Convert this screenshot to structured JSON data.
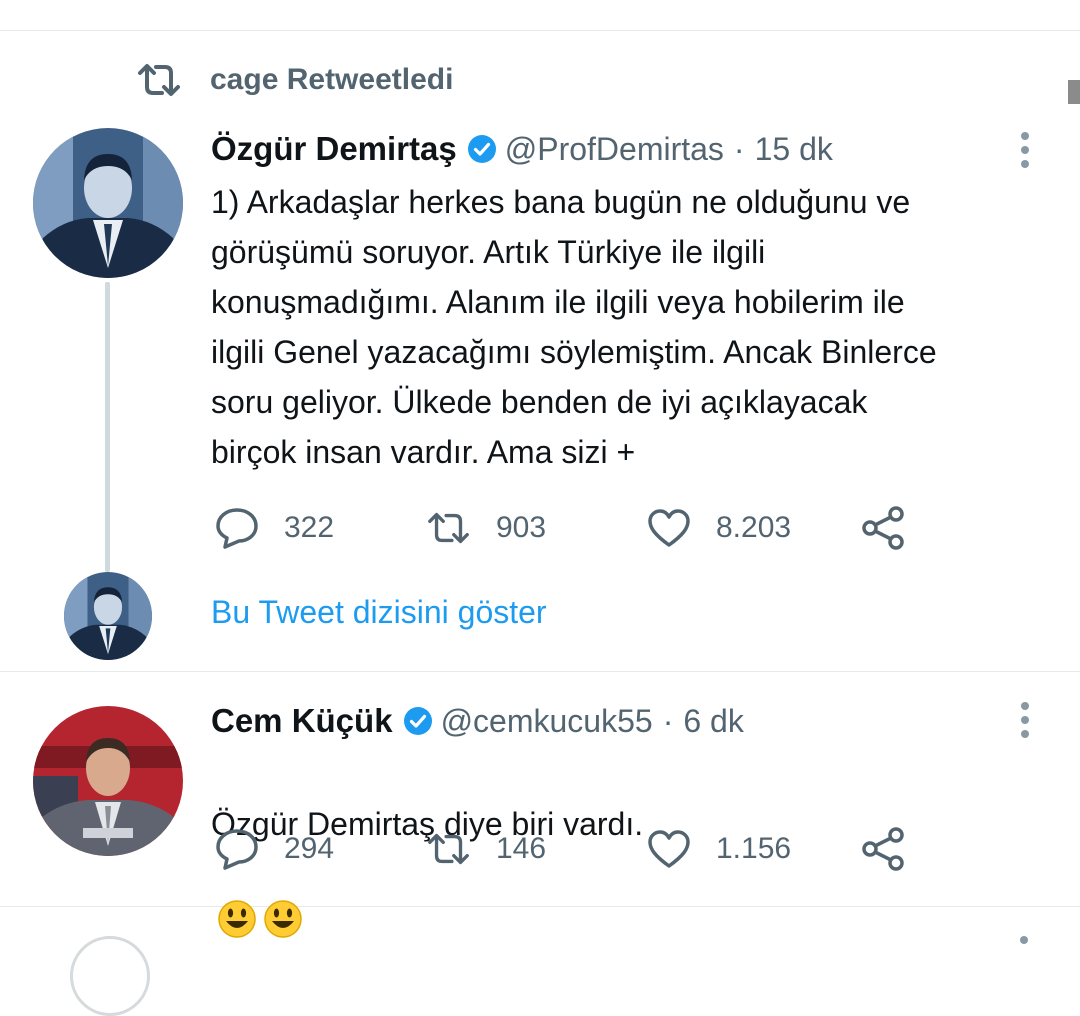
{
  "retweet_context": {
    "label": "cage Retweetledi"
  },
  "tweets": [
    {
      "name": "Özgür Demirtaş",
      "handle": "@ProfDemirtas",
      "separator": "·",
      "time": "15 dk",
      "text": "1) Arkadaşlar herkes bana bugün ne olduğunu ve\ngörüşümü soruyor. Artık Türkiye ile ilgili\nkonuşmadığımı. Alanım ile ilgili veya hobilerim ile\nilgili Genel yazacağımı söylemiştim. Ancak Binlerce\nsoru geliyor. Ülkede benden de iyi açıklayacak\nbirçok insan vardır. Ama sizi +",
      "replies": "322",
      "retweets": "903",
      "likes": "8.203"
    },
    {
      "name": "Cem Küçük",
      "handle": "@cemkucuk55",
      "separator": "·",
      "time": "6 dk",
      "text": "Özgür Demirtaş diye biri vardı.",
      "emojis": [
        "smiley-emoji",
        "smiley-emoji"
      ],
      "replies": "294",
      "retweets": "146",
      "likes": "1.156"
    }
  ],
  "show_thread_link": "Bu Tweet dizisini göster",
  "colors": {
    "link_blue": "#1d9bf0",
    "verified_blue": "#1d9bf0",
    "secondary_text": "#536471",
    "divider": "#e7eaec"
  }
}
